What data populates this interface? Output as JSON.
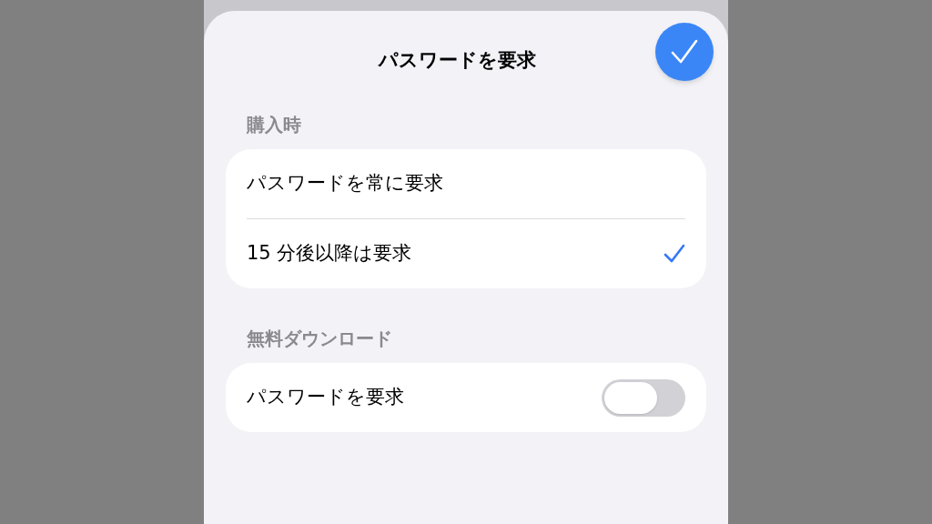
{
  "sheet": {
    "title": "パスワードを要求"
  },
  "sections": [
    {
      "header": "購入時",
      "rows": [
        {
          "label": "パスワードを常に要求",
          "kind": "choice",
          "selected": false
        },
        {
          "label": "15 分後以降は要求",
          "kind": "choice",
          "selected": true
        }
      ]
    },
    {
      "header": "無料ダウンロード",
      "rows": [
        {
          "label": "パスワードを要求",
          "kind": "toggle",
          "on": false
        }
      ]
    }
  ]
}
